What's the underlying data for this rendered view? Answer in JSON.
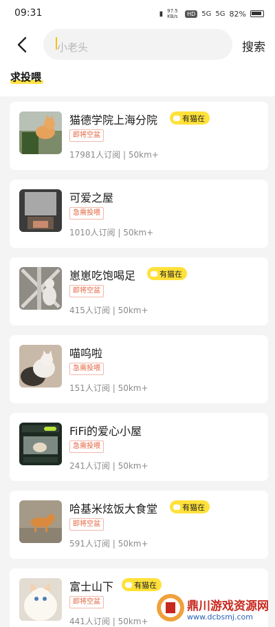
{
  "status_bar": {
    "time": "09:31",
    "net_speed": "97.5 KB/s",
    "hd_label": "HD",
    "signal1": "5G",
    "signal2": "5G",
    "battery": "82%"
  },
  "header": {
    "search_placeholder": "小老头",
    "search_button": "搜索",
    "back_icon": "chevron-left-icon"
  },
  "section": {
    "title": "求投喂",
    "accent_color": "#ffe34a"
  },
  "cards": [
    {
      "name": "猫德学院上海分院",
      "has_cat": true,
      "cat_badge": "有猫在",
      "tag": "即将空盆",
      "meta": "17981人订阅 | 50km+"
    },
    {
      "name": "可爱之屋",
      "has_cat": false,
      "cat_badge": "",
      "tag": "急需投喂",
      "meta": "1010人订阅 | 50km+"
    },
    {
      "name": "崽崽吃饱喝足",
      "has_cat": true,
      "cat_badge": "有猫在",
      "tag": "即将空盆",
      "meta": "415人订阅 | 50km+"
    },
    {
      "name": "喵呜啦",
      "has_cat": false,
      "cat_badge": "",
      "tag": "急需投喂",
      "meta": "151人订阅 | 50km+"
    },
    {
      "name": "FiFi的爱心小屋",
      "has_cat": false,
      "cat_badge": "",
      "tag": "急需投喂",
      "meta": "241人订阅 | 50km+"
    },
    {
      "name": "哈基米炫饭大食堂",
      "has_cat": true,
      "cat_badge": "有猫在",
      "tag": "即将空盆",
      "meta": "591人订阅 | 50km+"
    },
    {
      "name": "富士山下",
      "has_cat": true,
      "cat_badge": "有猫在",
      "tag": "即将空盆",
      "meta": "441人订阅 | 50km+"
    }
  ],
  "watermark": {
    "title": "鼎川游戏资源网",
    "url": "www.dcbsmj.com"
  }
}
